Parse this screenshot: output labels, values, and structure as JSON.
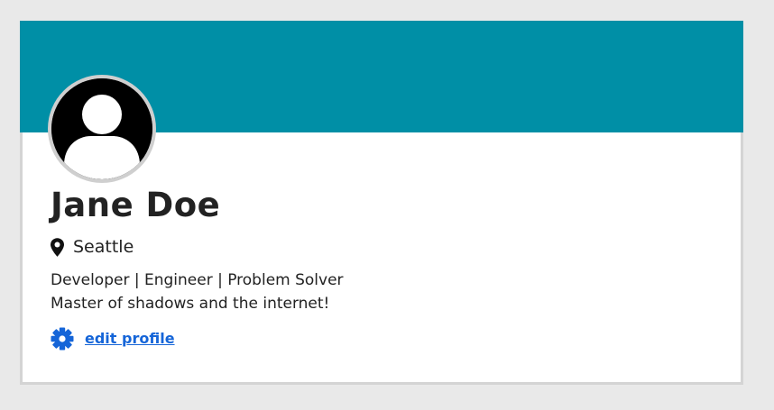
{
  "colors": {
    "banner": "#008fa6",
    "link": "#1565d8",
    "text": "#222222"
  },
  "profile": {
    "avatar_icon": "user-avatar-icon",
    "name": "Jane Doe",
    "location": {
      "icon": "map-pin-icon",
      "text": "Seattle"
    },
    "bio": {
      "line1": "Developer | Engineer | Problem Solver",
      "line2": "Master of shadows and the internet!"
    },
    "edit": {
      "icon": "gear-icon",
      "label": "edit profile"
    }
  }
}
